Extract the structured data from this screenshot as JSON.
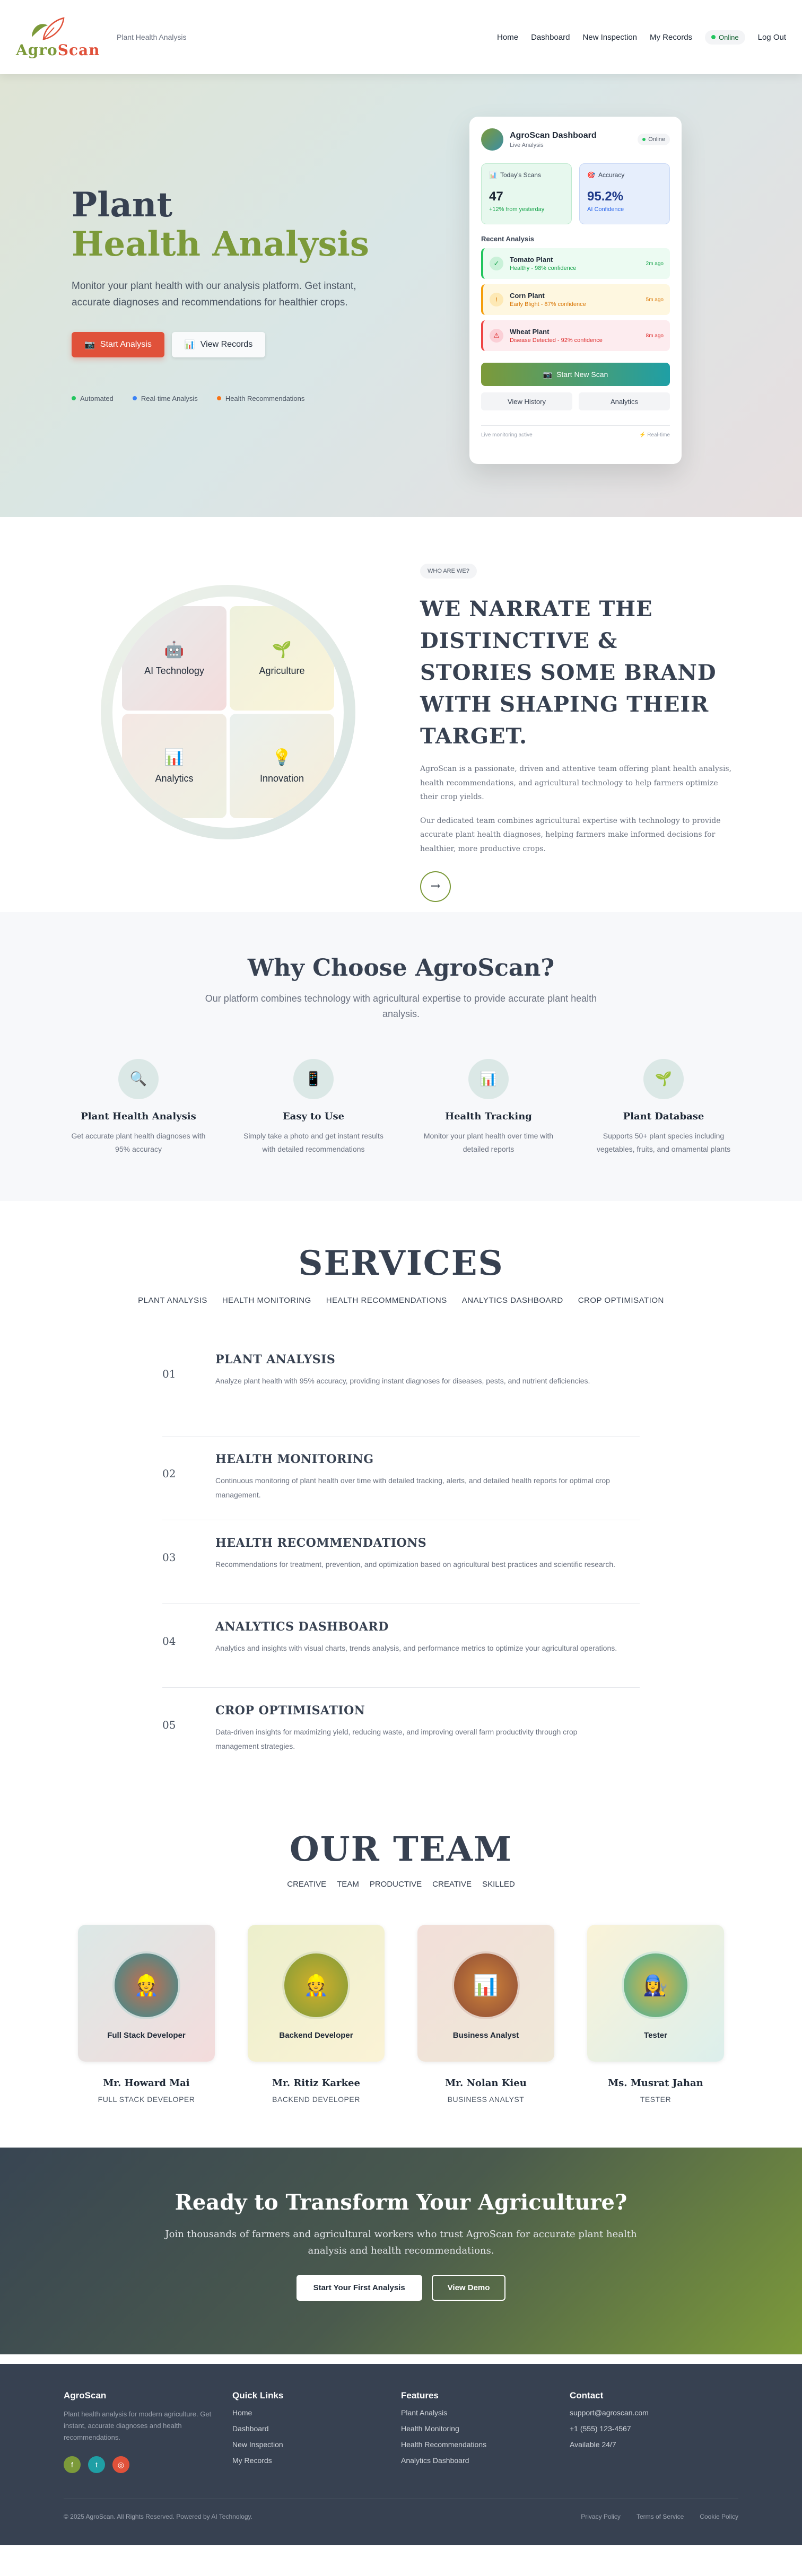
{
  "nav": {
    "logo_a": "Agro",
    "logo_b": "Scan",
    "subtitle": "Plant Health Analysis",
    "links": [
      "Home",
      "Dashboard",
      "New Inspection",
      "My Records"
    ],
    "status": "Online",
    "logout": "Log Out"
  },
  "hero": {
    "title1": "Plant",
    "title2": "Health Analysis",
    "desc": "Monitor your plant health with our analysis platform. Get instant, accurate diagnoses and recommendations for healthier crops.",
    "btn_primary": "Start Analysis",
    "btn_secondary": "View Records",
    "tags": [
      "Automated",
      "Real-time Analysis",
      "Health Recommendations"
    ]
  },
  "dashboard": {
    "title": "AgroScan Dashboard",
    "subtitle": "Live Analysis",
    "status": "Online",
    "stat1": {
      "label": "Today's Scans",
      "value": "47",
      "note": "+12% from yesterday"
    },
    "stat2": {
      "label": "Accuracy",
      "value": "95.2%",
      "note": "AI Confidence"
    },
    "recent_label": "Recent Analysis",
    "items": [
      {
        "name": "Tomato Plant",
        "status": "Healthy - 98% confidence",
        "time": "2m ago"
      },
      {
        "name": "Corn Plant",
        "status": "Early Blight - 87% confidence",
        "time": "5m ago"
      },
      {
        "name": "Wheat Plant",
        "status": "Disease Detected - 92% confidence",
        "time": "8m ago"
      }
    ],
    "scan_btn": "Start New Scan",
    "history_btn": "View History",
    "analytics_btn": "Analytics",
    "foot_left": "Live monitoring active",
    "foot_right": "Real-time"
  },
  "about": {
    "pill": "WHO ARE WE?",
    "heading": "WE NARRATE THE DISTINCTIVE & STORIES SOME BRAND WITH SHAPING THEIR TARGET.",
    "p1": "AgroScan is a passionate, driven and attentive team offering plant health analysis, health recommendations, and agricultural technology to help farmers optimize their crop yields.",
    "p2": "Our dedicated team combines agricultural expertise with technology to provide accurate plant health diagnoses, helping farmers make informed decisions for healthier, more productive crops.",
    "quads": [
      "AI Technology",
      "Agriculture",
      "Analytics",
      "Innovation"
    ]
  },
  "why": {
    "title": "Why Choose AgroScan?",
    "subtitle": "Our platform combines technology with agricultural expertise to provide accurate plant health analysis.",
    "features": [
      {
        "title": "Plant Health Analysis",
        "desc": "Get accurate plant health diagnoses with 95% accuracy"
      },
      {
        "title": "Easy to Use",
        "desc": "Simply take a photo and get instant results with detailed recommendations"
      },
      {
        "title": "Health Tracking",
        "desc": "Monitor your plant health over time with detailed reports"
      },
      {
        "title": "Plant Database",
        "desc": "Supports 50+ plant species including vegetables, fruits, and ornamental plants"
      }
    ]
  },
  "services": {
    "title": "SERVICES",
    "nav": [
      "PLANT ANALYSIS",
      "HEALTH MONITORING",
      "HEALTH RECOMMENDATIONS",
      "ANALYTICS DASHBOARD",
      "CROP OPTIMISATION"
    ],
    "items": [
      {
        "num": "01",
        "title": "PLANT ANALYSIS",
        "desc": "Analyze plant health with 95% accuracy, providing instant diagnoses for diseases, pests, and nutrient deficiencies."
      },
      {
        "num": "02",
        "title": "HEALTH MONITORING",
        "desc": "Continuous monitoring of plant health over time with detailed tracking, alerts, and detailed health reports for optimal crop management."
      },
      {
        "num": "03",
        "title": "HEALTH RECOMMENDATIONS",
        "desc": "Recommendations for treatment, prevention, and optimization based on agricultural best practices and scientific research."
      },
      {
        "num": "04",
        "title": "ANALYTICS DASHBOARD",
        "desc": "Analytics and insights with visual charts, trends analysis, and performance metrics to optimize your agricultural operations."
      },
      {
        "num": "05",
        "title": "CROP OPTIMISATION",
        "desc": "Data-driven insights for maximizing yield, reducing waste, and improving overall farm productivity through crop management strategies."
      }
    ]
  },
  "team": {
    "title": "OUR TEAM",
    "nav": [
      "CREATIVE",
      "TEAM",
      "PRODUCTIVE",
      "CREATIVE",
      "SKILLED"
    ],
    "members": [
      {
        "card_role": "Full Stack Developer",
        "name": "Mr. Howard Mai",
        "role": "FULL STACK DEVELOPER",
        "icon": "👷"
      },
      {
        "card_role": "Backend Developer",
        "name": "Mr. Ritiz Karkee",
        "role": "BACKEND DEVELOPER",
        "icon": "👷"
      },
      {
        "card_role": "Business Analyst",
        "name": "Mr. Nolan Kieu",
        "role": "BUSINESS ANALYST",
        "icon": "📊"
      },
      {
        "card_role": "Tester",
        "name": "Ms. Musrat Jahan",
        "role": "TESTER",
        "icon": "👩‍🔧"
      }
    ]
  },
  "cta": {
    "title": "Ready to Transform Your Agriculture?",
    "desc": "Join thousands of farmers and agricultural workers who trust AgroScan for accurate plant health analysis and health recommendations.",
    "btn1": "Start Your First Analysis",
    "btn2": "View Demo"
  },
  "footer": {
    "brand": "AgroScan",
    "desc": "Plant health analysis for modern agriculture. Get instant, accurate diagnoses and health recommendations.",
    "quick_title": "Quick Links",
    "quick_links": [
      "Home",
      "Dashboard",
      "New Inspection",
      "My Records"
    ],
    "features_title": "Features",
    "features_links": [
      "Plant Analysis",
      "Health Monitoring",
      "Health Recommendations",
      "Analytics Dashboard"
    ],
    "contact_title": "Contact",
    "contact_lines": [
      "support@agroscan.com",
      "+1 (555) 123-4567",
      "Available 24/7"
    ],
    "copyright": "© 2025 AgroScan. All Rights Reserved. Powered by AI Technology.",
    "legal": [
      "Privacy Policy",
      "Terms of Service",
      "Cookie Policy"
    ]
  },
  "colors": {
    "brand_red": "#e0513a",
    "brand_green": "#7c9a3a",
    "dark": "#374151"
  }
}
